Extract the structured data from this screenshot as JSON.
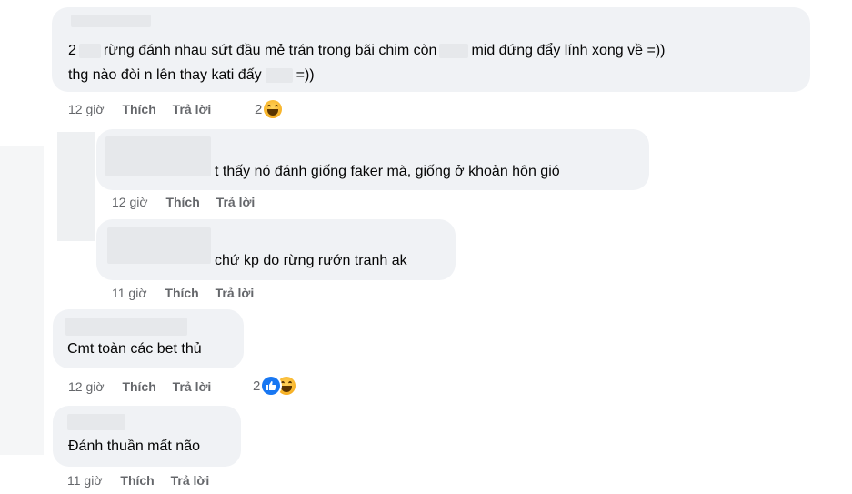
{
  "comments": [
    {
      "line1_a": "2",
      "line1_b": "rừng đánh nhau sứt đầu mẻ trán trong bãi chim còn",
      "line1_c": "mid đứng đẩy lính xong về =))",
      "line2_a": "thg nào đòi n lên thay kati đấy",
      "line2_b": "=))",
      "time": "12 giờ",
      "like": "Thích",
      "reply": "Trả lời",
      "reactions": "2"
    },
    {
      "text": "t thấy nó đánh giống faker mà, giống ở khoản hôn gió",
      "time": "12 giờ",
      "like": "Thích",
      "reply": "Trả lời"
    },
    {
      "text": "chứ kp do rừng rướn tranh ak",
      "time": "11 giờ",
      "like": "Thích",
      "reply": "Trả lời"
    },
    {
      "text": "Cmt toàn các bet thủ",
      "time": "12 giờ",
      "like": "Thích",
      "reply": "Trả lời",
      "reactions": "2"
    },
    {
      "text": "Đánh thuần mất não",
      "time": "11 giờ",
      "like": "Thích",
      "reply": "Trả lời"
    }
  ],
  "icons": [
    "haha-emoji-icon",
    "like-reaction-icon"
  ],
  "colors": {
    "bubble": "#f0f2f5",
    "meta": "#65676b",
    "like_blue": "#1877f2"
  }
}
